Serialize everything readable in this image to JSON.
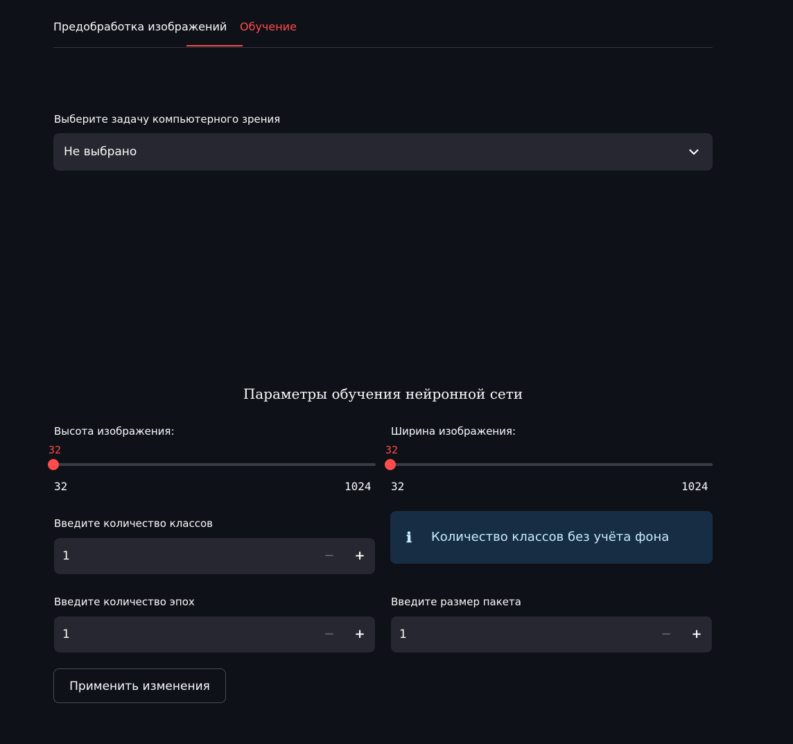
{
  "tabs": [
    {
      "label": "Предобработка изображений",
      "active": false
    },
    {
      "label": "Обучение",
      "active": true
    }
  ],
  "task_select": {
    "label": "Выберите задачу компьютерного зрения",
    "value": "Не выбрано",
    "icon": "chevron-down-icon"
  },
  "section_title": "Параметры обучения нейронной сети",
  "sliders": {
    "height": {
      "label": "Высота изображения:",
      "value": "32",
      "min": "32",
      "max": "1024"
    },
    "width": {
      "label": "Ширина изображения:",
      "value": "32",
      "min": "32",
      "max": "1024"
    }
  },
  "classes_input": {
    "label": "Введите количество классов",
    "value": "1",
    "minus": "−",
    "plus": "+"
  },
  "info": {
    "icon": "ℹ",
    "text": "Количество классов без учёта фона"
  },
  "epochs_input": {
    "label": "Введите количество эпох",
    "value": "1",
    "minus": "−",
    "plus": "+"
  },
  "batch_input": {
    "label": "Введите размер пакета",
    "value": "1",
    "minus": "−",
    "plus": "+"
  },
  "apply_button": {
    "label": "Применить изменения"
  },
  "colors": {
    "background": "#0e1117",
    "accent": "#ff4b4b",
    "input_bg": "#262730",
    "info_bg": "#172d43",
    "info_text": "#c7ebff"
  }
}
